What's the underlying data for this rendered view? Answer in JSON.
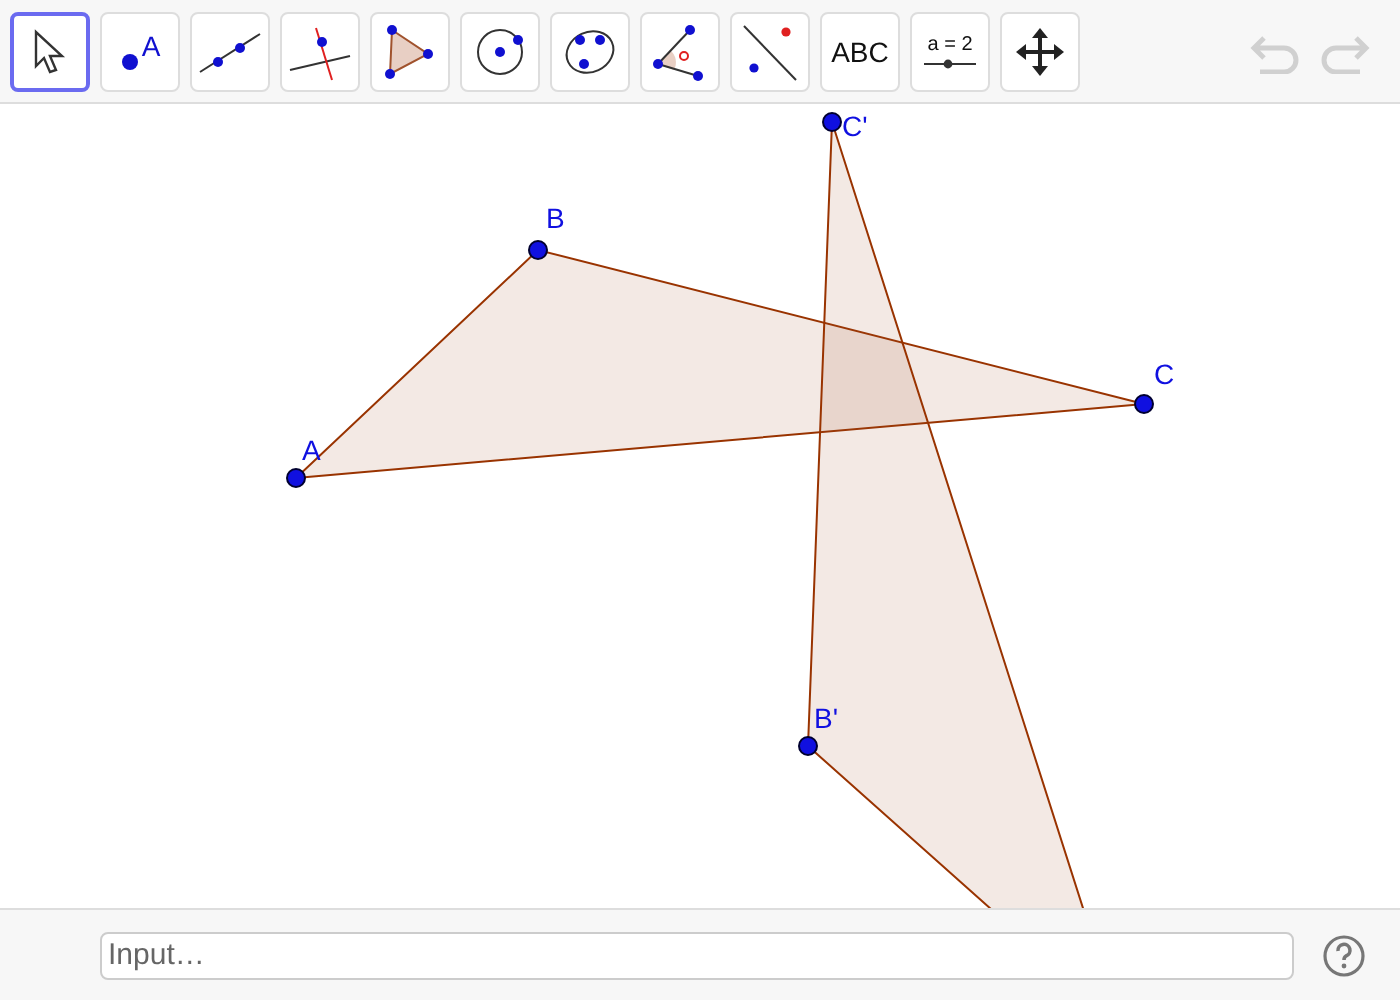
{
  "toolbar": {
    "tools": [
      {
        "kind": "move",
        "selected": true
      },
      {
        "kind": "point",
        "label": "A",
        "selected": false
      },
      {
        "kind": "line",
        "selected": false
      },
      {
        "kind": "perpendicular",
        "selected": false
      },
      {
        "kind": "polygon",
        "selected": false
      },
      {
        "kind": "circle",
        "selected": false
      },
      {
        "kind": "conic",
        "selected": false
      },
      {
        "kind": "angle",
        "selected": false
      },
      {
        "kind": "reflect",
        "selected": false
      },
      {
        "kind": "text",
        "label": "ABC",
        "selected": false
      },
      {
        "kind": "slider",
        "label": "a = 2",
        "selected": false
      },
      {
        "kind": "pan",
        "selected": false
      }
    ],
    "undo": {
      "disabled": true
    },
    "redo": {
      "disabled": true
    }
  },
  "canvas": {
    "points": [
      {
        "label": "A"
      },
      {
        "label": "B"
      },
      {
        "label": "C"
      },
      {
        "label": "C'"
      },
      {
        "label": "B'"
      }
    ]
  },
  "input_bar": {
    "placeholder": "Input…"
  }
}
